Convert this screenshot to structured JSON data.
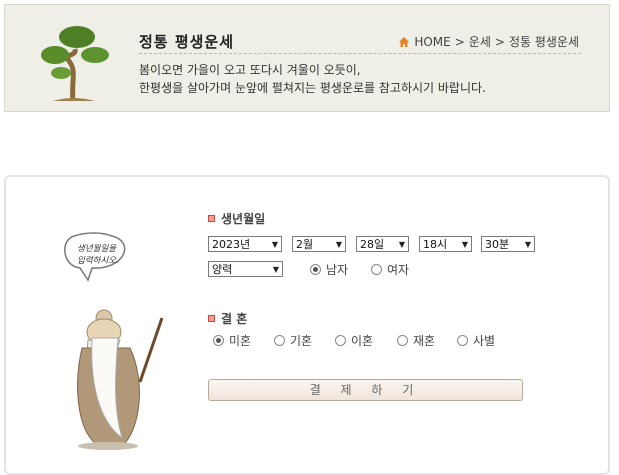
{
  "header": {
    "title": "정통 평생운세",
    "breadcrumb": [
      "HOME",
      ">",
      "운세",
      ">",
      "정통 평생운세"
    ],
    "desc_line1": "봄이오면 가을이 오고 또다시 겨울이 오듯이,",
    "desc_line2": "한평생을 살아가며 눈앞에 펼쳐지는 평생운로를 참고하시기 바랍니다."
  },
  "speech_bubble": [
    "생년월일을",
    "입력하시오."
  ],
  "birth": {
    "section_title": "생년월일",
    "year": "2023년",
    "month": "2월",
    "day": "28일",
    "hour": "18시",
    "minute": "30분",
    "calendar": "양력",
    "gender_options": [
      "남자",
      "여자"
    ],
    "gender_selected": "남자"
  },
  "marriage": {
    "section_title": "결 혼",
    "options": [
      "미혼",
      "기혼",
      "이혼",
      "재혼",
      "사별"
    ],
    "selected": "미혼"
  },
  "pay_button": "결 제 하 기",
  "colors": {
    "header_bg": "#efefe7",
    "bullet": "#f0a08a",
    "home_icon": "#e8821e"
  }
}
